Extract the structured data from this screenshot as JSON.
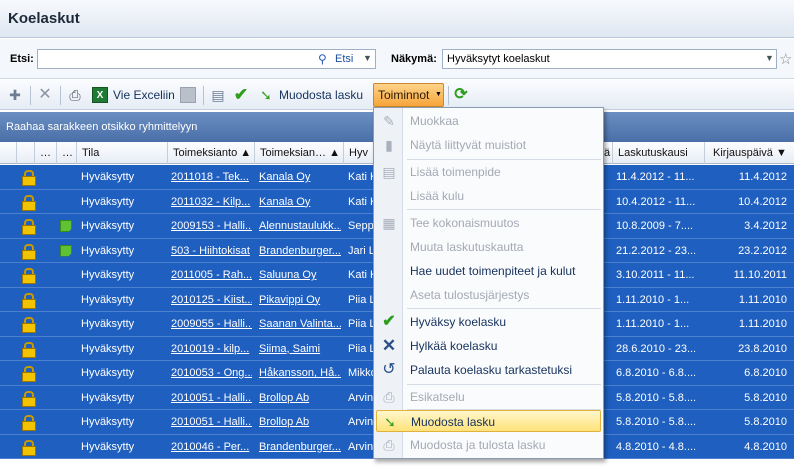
{
  "title": "Koelaskut",
  "search": {
    "label": "Etsi:",
    "value": "",
    "button": "Etsi",
    "view_label": "Näkymä:",
    "view_value": "Hyväksytyt koelaskut"
  },
  "toolbar": {
    "excel": "Vie Exceliin",
    "create_invoice": "Muodosta lasku",
    "actions": "Toiminnot"
  },
  "group_hint": "Raahaa sarakkeen otsikko ryhmittelyyn",
  "columns": {
    "c1": "…",
    "c2": "…",
    "tila": "Tila",
    "toimeksianto": "Toimeksianto ▲",
    "toimeksiantaja": "Toimeksian… ▲",
    "hyv": "Hyv",
    "a": "ä",
    "laskutuskausi": "Laskutuskausi",
    "kirjauspaiva": "Kirjauspäivä ▼"
  },
  "rows": [
    {
      "tila": "Hyväksytty",
      "toim": "2011018 - Tek...",
      "antaja": "Kanala Oy",
      "hyv": "Kati K",
      "kausi": "11.4.2012 - 11...",
      "kirj": "11.4.2012"
    },
    {
      "tila": "Hyväksytty",
      "toim": "2011032 - Kilp...",
      "antaja": "Kanala Oy",
      "hyv": "Kati K",
      "kausi": "10.4.2012 - 11...",
      "kirj": "10.4.2012"
    },
    {
      "tila": "Hyväksytty",
      "toim": "2009153 - Halli...",
      "antaja": "Alennustaulukk...",
      "hyv": "Sepp",
      "kausi": "10.8.2009 - 7....",
      "kirj": "3.4.2012"
    },
    {
      "tila": "Hyväksytty",
      "toim": "503 - Hiihtokisat",
      "antaja": "Brandenburger...",
      "hyv": "Jari L",
      "kausi": "21.2.2012 - 23...",
      "kirj": "23.2.2012"
    },
    {
      "tila": "Hyväksytty",
      "toim": "2011005 - Rah...",
      "antaja": "Saluuna Oy",
      "hyv": "Kati K",
      "kausi": "3.10.2011 - 11...",
      "kirj": "11.10.2011"
    },
    {
      "tila": "Hyväksytty",
      "toim": "2010125 - Kiist...",
      "antaja": "Pikavippi Oy",
      "hyv": "Piia L",
      "kausi": "1.11.2010 - 1...",
      "kirj": "1.11.2010"
    },
    {
      "tila": "Hyväksytty",
      "toim": "2009055 - Halli...",
      "antaja": "Saanan Valinta...",
      "hyv": "Piia L",
      "kausi": "1.11.2010 - 1...",
      "kirj": "1.11.2010"
    },
    {
      "tila": "Hyväksytty",
      "toim": "2010019 - kilp...",
      "antaja": "Siima, Saimi",
      "hyv": "Piia L",
      "kausi": "28.6.2010 - 23...",
      "kirj": "23.8.2010"
    },
    {
      "tila": "Hyväksytty",
      "toim": "2010053 - Ong...",
      "antaja": "Håkansson, Hå...",
      "hyv": "Mikko",
      "kausi": "6.8.2010 - 6.8....",
      "kirj": "6.8.2010"
    },
    {
      "tila": "Hyväksytty",
      "toim": "2010051 - Halli...",
      "antaja": "Brollop Ab",
      "hyv": "Arvin",
      "kausi": "5.8.2010 - 5.8....",
      "kirj": "5.8.2010"
    },
    {
      "tila": "Hyväksytty",
      "toim": "2010051 - Halli...",
      "antaja": "Brollop Ab",
      "hyv": "Arvin",
      "kausi": "5.8.2010 - 5.8....",
      "kirj": "5.8.2010"
    },
    {
      "tila": "Hyväksytty",
      "toim": "2010046 - Per...",
      "antaja": "Brandenburger...",
      "hyv": "Arvin",
      "kausi": "4.8.2010 - 4.8....",
      "kirj": "4.8.2010"
    }
  ],
  "menu": {
    "edit": "Muokkaa",
    "show_notes": "Näytä liittyvät muistiot",
    "add_action": "Lisää toimenpide",
    "add_cost": "Lisää kulu",
    "total_change": "Tee kokonaismuutos",
    "change_period": "Muuta laskutuskautta",
    "fetch_new": "Hae uudet toimenpiteet ja kulut",
    "print_order": "Aseta tulostusjärjestys",
    "approve": "Hyväksy koelasku",
    "reject": "Hylkää koelasku",
    "return": "Palauta koelasku tarkastetuksi",
    "preview": "Esikatselu",
    "create": "Muodosta lasku",
    "create_print": "Muodosta ja tulosta lasku"
  }
}
